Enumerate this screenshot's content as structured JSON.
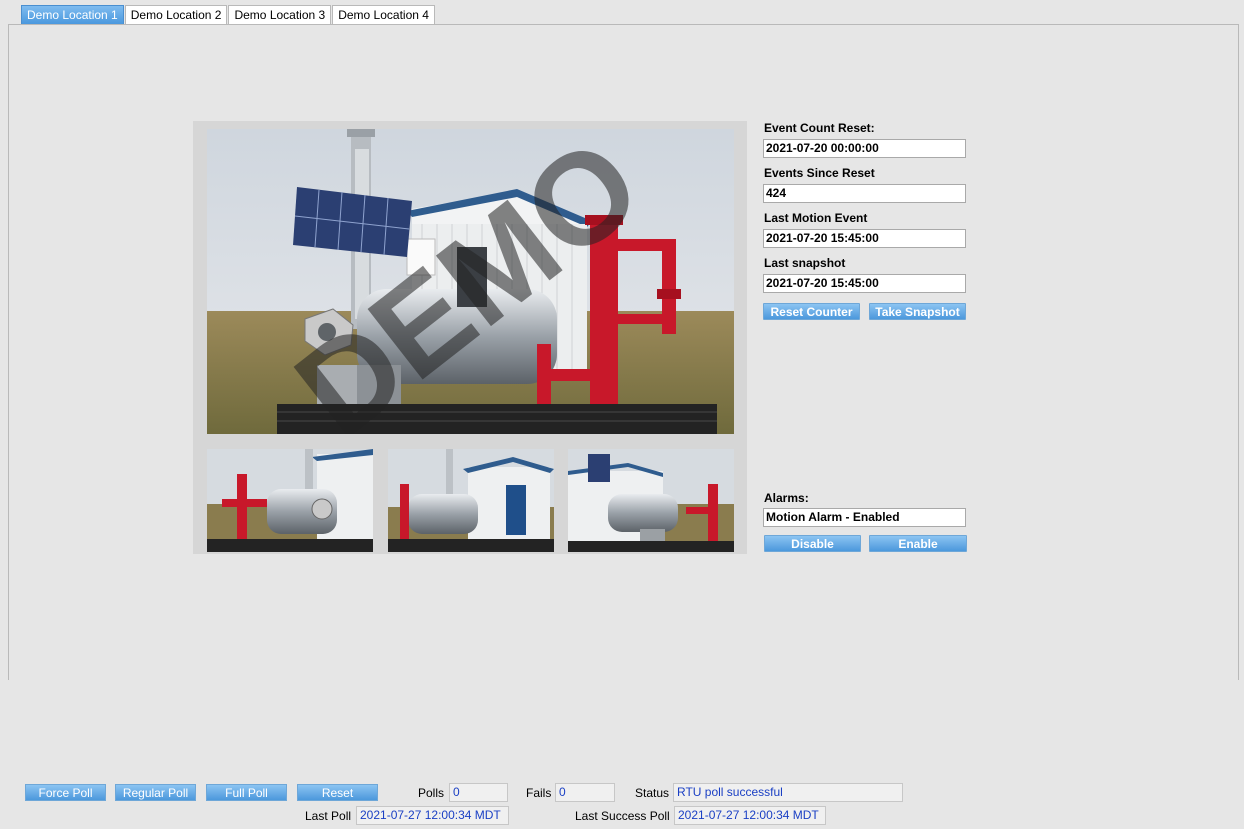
{
  "tabs": [
    {
      "label": "Demo Location 1",
      "active": true
    },
    {
      "label": "Demo Location 2",
      "active": false
    },
    {
      "label": "Demo Location 3",
      "active": false
    },
    {
      "label": "Demo Location 4",
      "active": false
    }
  ],
  "camera": {
    "watermark": "DEMO"
  },
  "info": {
    "event_count_reset_label": "Event Count Reset:",
    "event_count_reset_value": "2021-07-20 00:00:00",
    "events_since_reset_label": "Events Since Reset",
    "events_since_reset_value": "424",
    "last_motion_event_label": "Last Motion Event",
    "last_motion_event_value": "2021-07-20 15:45:00",
    "last_snapshot_label": "Last snapshot",
    "last_snapshot_value": "2021-07-20 15:45:00",
    "reset_counter_button": "Reset Counter",
    "take_snapshot_button": "Take Snapshot"
  },
  "alarms": {
    "label": "Alarms:",
    "value": "Motion Alarm - Enabled",
    "disable_button": "Disable",
    "enable_button": "Enable"
  },
  "poll_bar": {
    "force_poll": "Force Poll",
    "regular_poll": "Regular Poll",
    "full_poll": "Full Poll",
    "reset": "Reset",
    "polls_label": "Polls",
    "polls_value": "0",
    "fails_label": "Fails",
    "fails_value": "0",
    "status_label": "Status",
    "status_value": "RTU poll successful",
    "last_poll_label": "Last Poll",
    "last_poll_value": "2021-07-27 12:00:34 MDT",
    "last_success_poll_label": "Last Success Poll",
    "last_success_poll_value": "2021-07-27 12:00:34 MDT"
  },
  "colors": {
    "accent": "#4a98de",
    "value_text": "#1a3fc4",
    "equipment_red": "#c8182a"
  }
}
